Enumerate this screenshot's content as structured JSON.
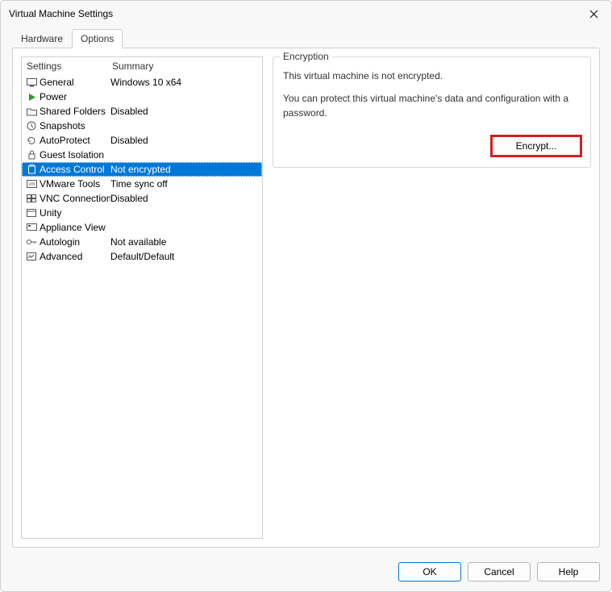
{
  "window": {
    "title": "Virtual Machine Settings"
  },
  "tabs": {
    "hardware": "Hardware",
    "options": "Options"
  },
  "list": {
    "header_settings": "Settings",
    "header_summary": "Summary",
    "rows": [
      {
        "label": "General",
        "summary": "Windows 10 x64"
      },
      {
        "label": "Power",
        "summary": ""
      },
      {
        "label": "Shared Folders",
        "summary": "Disabled"
      },
      {
        "label": "Snapshots",
        "summary": ""
      },
      {
        "label": "AutoProtect",
        "summary": "Disabled"
      },
      {
        "label": "Guest Isolation",
        "summary": ""
      },
      {
        "label": "Access Control",
        "summary": "Not encrypted"
      },
      {
        "label": "VMware Tools",
        "summary": "Time sync off"
      },
      {
        "label": "VNC Connections",
        "summary": "Disabled"
      },
      {
        "label": "Unity",
        "summary": ""
      },
      {
        "label": "Appliance View",
        "summary": ""
      },
      {
        "label": "Autologin",
        "summary": "Not available"
      },
      {
        "label": "Advanced",
        "summary": "Default/Default"
      }
    ]
  },
  "encryption": {
    "groupbox_title": "Encryption",
    "line1": "This virtual machine is not encrypted.",
    "line2": "You can protect this virtual machine's data and configuration with a password.",
    "button": "Encrypt..."
  },
  "footer": {
    "ok": "OK",
    "cancel": "Cancel",
    "help": "Help"
  }
}
